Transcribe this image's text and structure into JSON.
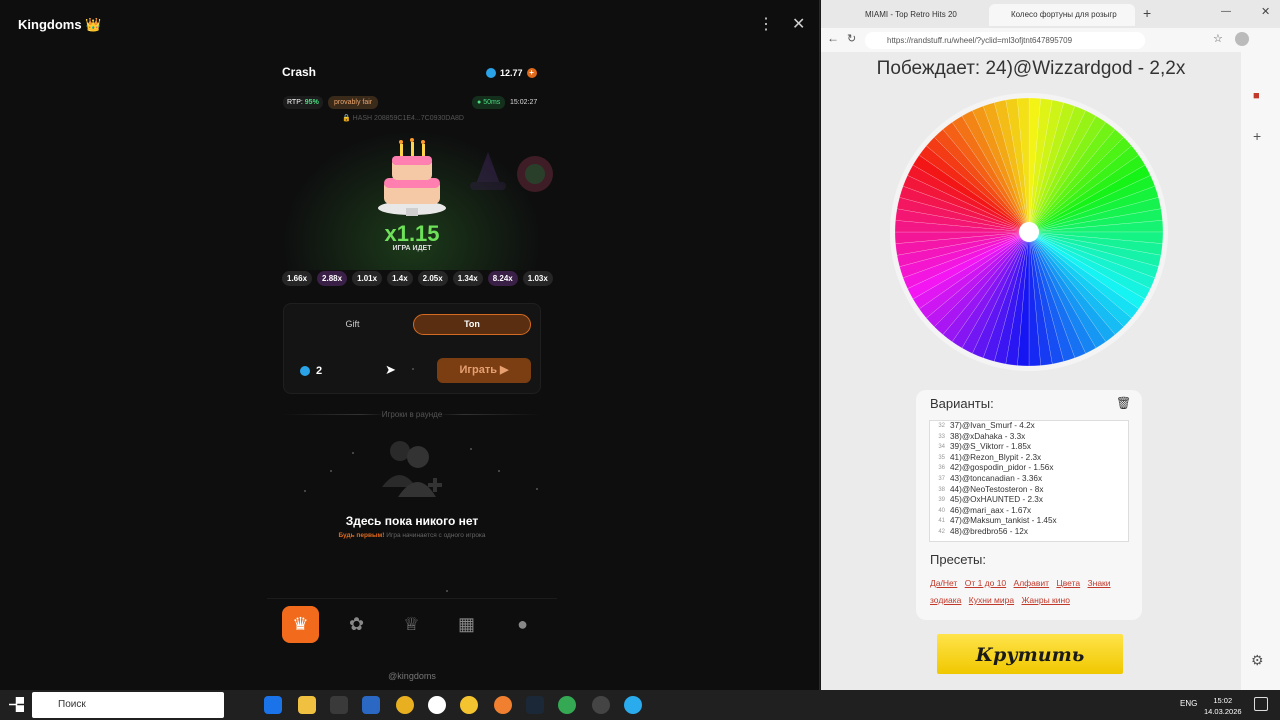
{
  "telegram": {
    "title": "Kingdoms 👑",
    "menu_icon": "⋮",
    "close_icon": "✕"
  },
  "game": {
    "name": "Crash",
    "balance": "12.77",
    "rtp_label": "RTP:",
    "rtp_value": "95%",
    "provably_fair": "provably fair",
    "ping": "50ms",
    "time": "15:02:27",
    "hash": "🔒 HASH  208859C1E4...7C0930DA8D",
    "multiplier": "x1.15",
    "status": "ИГРА ИДЕТ",
    "history": [
      "1.66x",
      "2.88x",
      "1.01x",
      "1.4x",
      "2.05x",
      "1.34x",
      "8.24x",
      "1.03x"
    ],
    "tabs": [
      "Gift",
      "Ton"
    ],
    "active_tab": "Ton",
    "bet_amount": "2",
    "play_label": "Играть",
    "players_heading": "Игроки в раунде",
    "empty_title": "Здесь пока никого нет",
    "empty_sub_highlight": "Будь первым!",
    "empty_sub": "Игра начинается с одного игрока",
    "footer_handle": "@kingdoms"
  },
  "browser": {
    "tab1_title": "MIAMI - Top Retro Hits 20",
    "tab2_title": "Колесо фортуны для розыгр",
    "url": "https://randstuff.ru/wheel/?yclid=ml3ofjtnt647895709",
    "winner": "Побеждает: 24)@Wizzardgod - 2,2x",
    "variants_title": "Варианты:",
    "variants": [
      {
        "n": "32",
        "t": "37)@Ivan_Smurf - 4.2x"
      },
      {
        "n": "33",
        "t": "38)@xDahaka - 3.3x"
      },
      {
        "n": "34",
        "t": "39)@S_Viktorr - 1.85x"
      },
      {
        "n": "35",
        "t": "41)@Rezon_Blypit - 2.3x"
      },
      {
        "n": "36",
        "t": "42)@gospodin_pidor - 1.56x"
      },
      {
        "n": "37",
        "t": "43)@toncanadian - 3.36x"
      },
      {
        "n": "38",
        "t": "44)@NeoTestosteron - 8x"
      },
      {
        "n": "39",
        "t": "45)@OxHAUNTED - 2.3x"
      },
      {
        "n": "40",
        "t": "46)@mari_aax - 1.67x"
      },
      {
        "n": "41",
        "t": "47)@Maksum_tankist - 1.45x"
      },
      {
        "n": "42",
        "t": "48)@bredbro56 - 12x"
      }
    ],
    "presets_title": "Пресеты:",
    "presets": [
      "Да/Нет",
      "От 1 до 10",
      "Алфавит",
      "Цвета",
      "Знаки зодиака",
      "Кухни мира",
      "Жанры кино"
    ],
    "spin_label": "Крутить"
  },
  "taskbar": {
    "search_placeholder": "Поиск",
    "lang": "ENG",
    "time": "15:02",
    "date": "14.03.2026"
  },
  "colors": {
    "accent_orange": "#d46b22",
    "multiplier_green": "#6ee05a",
    "spin_yellow": "#f0c800",
    "preset_red": "#c0392b"
  }
}
